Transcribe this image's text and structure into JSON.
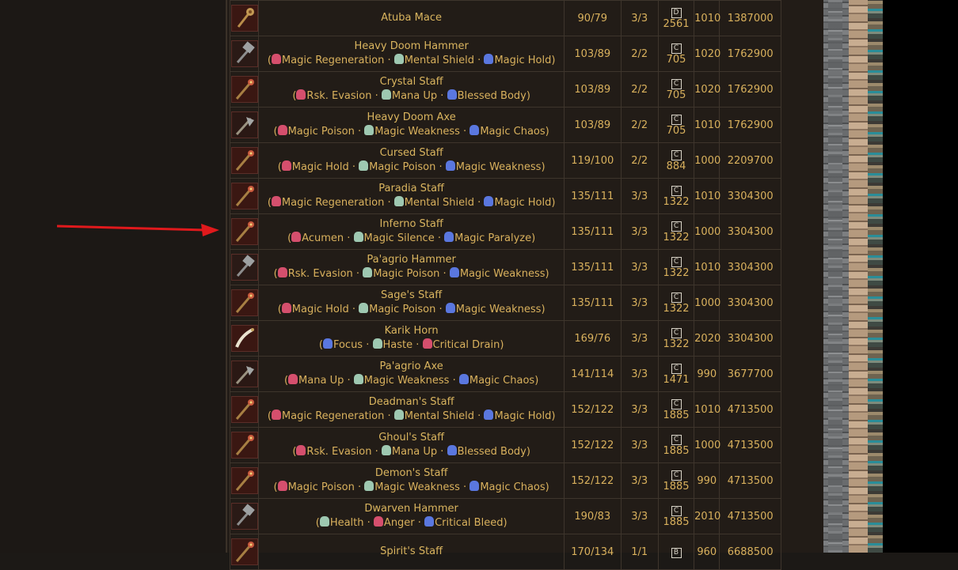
{
  "theme": {
    "accent": "#d9b15d",
    "background": "#221c17",
    "arrow": "#e0191c"
  },
  "rows": [
    {
      "icon": "mace-icon",
      "name": "Atuba Mace",
      "sa": [],
      "atk": "90/79",
      "slots": "3/3",
      "grade": "D",
      "gradeNum": "2561",
      "speed": "1010",
      "price": "1387000"
    },
    {
      "icon": "hammer-icon",
      "name": "Heavy Doom Hammer",
      "sa": [
        {
          "c": "red",
          "t": "Magic Regeneration"
        },
        {
          "c": "green",
          "t": "Mental Shield"
        },
        {
          "c": "blue",
          "t": "Magic Hold"
        }
      ],
      "atk": "103/89",
      "slots": "2/2",
      "grade": "C",
      "gradeNum": "705",
      "speed": "1020",
      "price": "1762900"
    },
    {
      "icon": "staff-icon",
      "name": "Crystal Staff",
      "sa": [
        {
          "c": "red",
          "t": "Rsk. Evasion"
        },
        {
          "c": "green",
          "t": "Mana Up"
        },
        {
          "c": "blue",
          "t": "Blessed Body"
        }
      ],
      "atk": "103/89",
      "slots": "2/2",
      "grade": "C",
      "gradeNum": "705",
      "speed": "1020",
      "price": "1762900"
    },
    {
      "icon": "axe-icon",
      "name": "Heavy Doom Axe",
      "sa": [
        {
          "c": "red",
          "t": "Magic Poison"
        },
        {
          "c": "green",
          "t": "Magic Weakness"
        },
        {
          "c": "blue",
          "t": "Magic Chaos"
        }
      ],
      "atk": "103/89",
      "slots": "2/2",
      "grade": "C",
      "gradeNum": "705",
      "speed": "1010",
      "price": "1762900"
    },
    {
      "icon": "staff-icon",
      "name": "Cursed Staff",
      "sa": [
        {
          "c": "red",
          "t": "Magic Hold"
        },
        {
          "c": "green",
          "t": "Magic Poison"
        },
        {
          "c": "blue",
          "t": "Magic Weakness"
        }
      ],
      "atk": "119/100",
      "slots": "2/2",
      "grade": "C",
      "gradeNum": "884",
      "speed": "1000",
      "price": "2209700"
    },
    {
      "icon": "staff-icon",
      "name": "Paradia Staff",
      "sa": [
        {
          "c": "red",
          "t": "Magic Regeneration"
        },
        {
          "c": "green",
          "t": "Mental Shield"
        },
        {
          "c": "blue",
          "t": "Magic Hold"
        }
      ],
      "atk": "135/111",
      "slots": "3/3",
      "grade": "C",
      "gradeNum": "1322",
      "speed": "1010",
      "price": "3304300"
    },
    {
      "icon": "staff-icon",
      "name": "Inferno Staff",
      "sa": [
        {
          "c": "red",
          "t": "Acumen"
        },
        {
          "c": "green",
          "t": "Magic Silence"
        },
        {
          "c": "blue",
          "t": "Magic Paralyze"
        }
      ],
      "atk": "135/111",
      "slots": "3/3",
      "grade": "C",
      "gradeNum": "1322",
      "speed": "1000",
      "price": "3304300"
    },
    {
      "icon": "hammer-icon",
      "name": "Pa'agrio Hammer",
      "sa": [
        {
          "c": "red",
          "t": "Rsk. Evasion"
        },
        {
          "c": "green",
          "t": "Magic Poison"
        },
        {
          "c": "blue",
          "t": "Magic Weakness"
        }
      ],
      "atk": "135/111",
      "slots": "3/3",
      "grade": "C",
      "gradeNum": "1322",
      "speed": "1010",
      "price": "3304300"
    },
    {
      "icon": "staff-icon",
      "name": "Sage's Staff",
      "sa": [
        {
          "c": "red",
          "t": "Magic Hold"
        },
        {
          "c": "green",
          "t": "Magic Poison"
        },
        {
          "c": "blue",
          "t": "Magic Weakness"
        }
      ],
      "atk": "135/111",
      "slots": "3/3",
      "grade": "C",
      "gradeNum": "1322",
      "speed": "1000",
      "price": "3304300"
    },
    {
      "icon": "horn-icon",
      "name": "Karik Horn",
      "sa": [
        {
          "c": "blue",
          "t": "Focus"
        },
        {
          "c": "green",
          "t": "Haste"
        },
        {
          "c": "red",
          "t": "Critical Drain"
        }
      ],
      "atk": "169/76",
      "slots": "3/3",
      "grade": "C",
      "gradeNum": "1322",
      "speed": "2020",
      "price": "3304300"
    },
    {
      "icon": "axe-icon",
      "name": "Pa'agrio Axe",
      "sa": [
        {
          "c": "red",
          "t": "Mana Up"
        },
        {
          "c": "green",
          "t": "Magic Weakness"
        },
        {
          "c": "blue",
          "t": "Magic Chaos"
        }
      ],
      "atk": "141/114",
      "slots": "3/3",
      "grade": "C",
      "gradeNum": "1471",
      "speed": "990",
      "price": "3677700"
    },
    {
      "icon": "staff-icon",
      "name": "Deadman's Staff",
      "sa": [
        {
          "c": "red",
          "t": "Magic Regeneration"
        },
        {
          "c": "green",
          "t": "Mental Shield"
        },
        {
          "c": "blue",
          "t": "Magic Hold"
        }
      ],
      "atk": "152/122",
      "slots": "3/3",
      "grade": "C",
      "gradeNum": "1885",
      "speed": "1010",
      "price": "4713500"
    },
    {
      "icon": "staff-icon",
      "name": "Ghoul's Staff",
      "sa": [
        {
          "c": "red",
          "t": "Rsk. Evasion"
        },
        {
          "c": "green",
          "t": "Mana Up"
        },
        {
          "c": "blue",
          "t": "Blessed Body"
        }
      ],
      "atk": "152/122",
      "slots": "3/3",
      "grade": "C",
      "gradeNum": "1885",
      "speed": "1000",
      "price": "4713500"
    },
    {
      "icon": "staff-icon",
      "name": "Demon's Staff",
      "sa": [
        {
          "c": "red",
          "t": "Magic Poison"
        },
        {
          "c": "green",
          "t": "Magic Weakness"
        },
        {
          "c": "blue",
          "t": "Magic Chaos"
        }
      ],
      "atk": "152/122",
      "slots": "3/3",
      "grade": "C",
      "gradeNum": "1885",
      "speed": "990",
      "price": "4713500"
    },
    {
      "icon": "hammer-icon",
      "name": "Dwarven Hammer",
      "sa": [
        {
          "c": "green",
          "t": "Health"
        },
        {
          "c": "red",
          "t": "Anger"
        },
        {
          "c": "blue",
          "t": "Critical Bleed"
        }
      ],
      "atk": "190/83",
      "slots": "3/3",
      "grade": "C",
      "gradeNum": "1885",
      "speed": "2010",
      "price": "4713500"
    },
    {
      "icon": "staff-icon",
      "name": "Spirit's Staff",
      "sa": [],
      "atk": "170/134",
      "slots": "1/1",
      "grade": "B",
      "gradeNum": "",
      "speed": "960",
      "price": "6688500"
    }
  ]
}
